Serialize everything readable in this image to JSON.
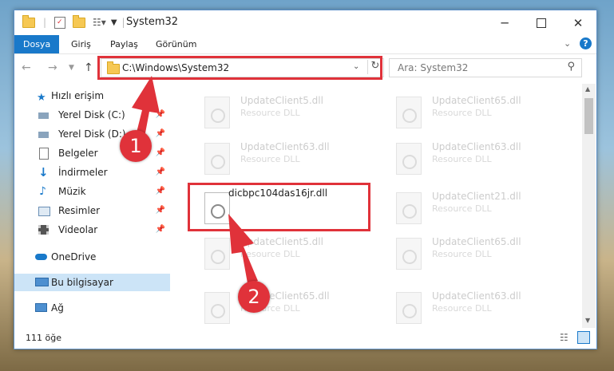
{
  "window": {
    "title": "System32"
  },
  "ribbon": {
    "tabs": [
      "Dosya",
      "Giriş",
      "Paylaş",
      "Görünüm"
    ]
  },
  "address": {
    "path": "C:\\Windows\\System32"
  },
  "search": {
    "placeholder": "Ara: System32"
  },
  "nav": {
    "quick_access": "Hızlı erişim",
    "items": [
      "Yerel Disk (C:)",
      "Yerel Disk (D:)",
      "Belgeler",
      "İndirmeler",
      "Müzik",
      "Resimler",
      "Videolar"
    ],
    "onedrive": "OneDrive",
    "this_pc": "Bu bilgisayar",
    "network": "Ağ"
  },
  "files": {
    "left": [
      {
        "name": "UpdateClient5.dll",
        "type": "Resource DLL"
      },
      {
        "name": "UpdateClient63.dll",
        "type": "Resource DLL"
      },
      {
        "name": "dicbpc104das16jr.dll",
        "type": ""
      },
      {
        "name": "UpdateClient5.dll",
        "type": "Resource DLL"
      },
      {
        "name": "UpdateClient65.dll",
        "type": "Resource DLL"
      }
    ],
    "right": [
      {
        "name": "UpdateClient65.dll",
        "type": "Resource DLL"
      },
      {
        "name": "UpdateClient63.dll",
        "type": "Resource DLL"
      },
      {
        "name": "UpdateClient21.dll",
        "type": "Resource DLL"
      },
      {
        "name": "UpdateClient65.dll",
        "type": "Resource DLL"
      },
      {
        "name": "UpdateClient63.dll",
        "type": "Resource DLL"
      }
    ]
  },
  "status": {
    "count": "111 öğe"
  },
  "callouts": [
    "1",
    "2"
  ],
  "colors": {
    "accent": "#1979ca",
    "highlight": "#e0323a",
    "selection": "#cce4f7"
  }
}
